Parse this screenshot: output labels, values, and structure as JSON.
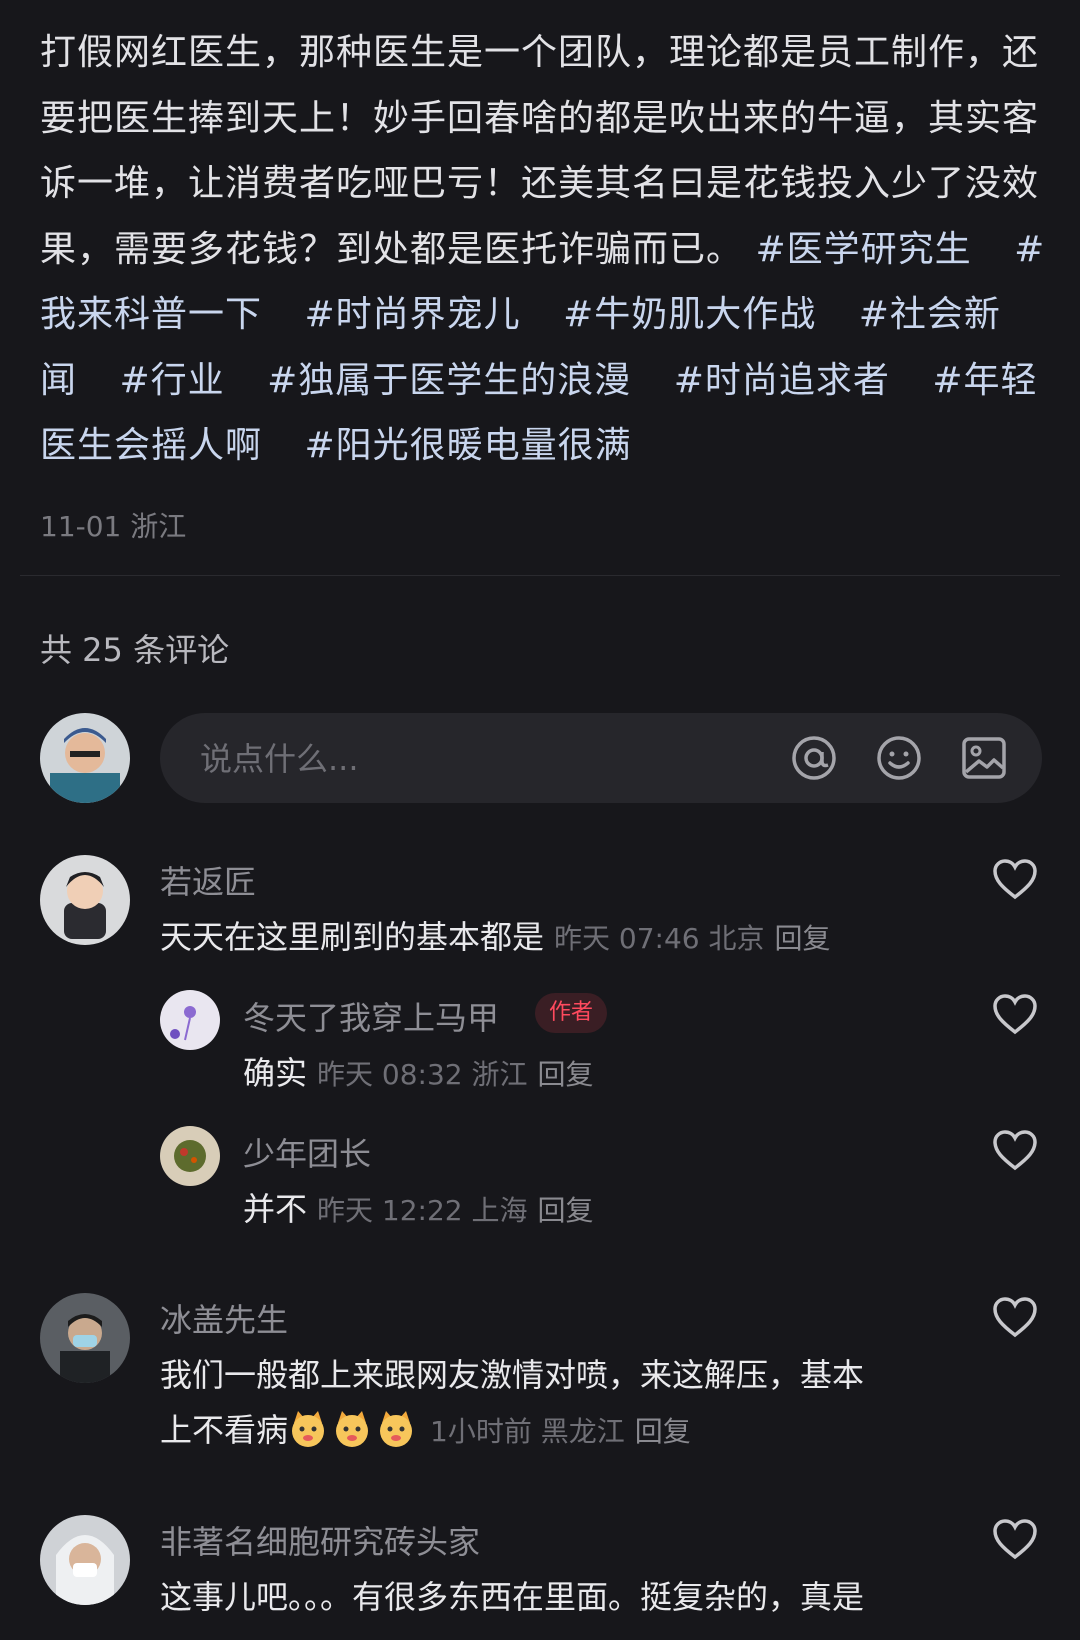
{
  "post": {
    "text": "打假网红医生，那种医生是一个团队，理论都是员工制作，还要把医生捧到天上！妙手回春啥的都是吹出来的牛逼，其实客诉一堆，让消费者吃哑巴亏！还美其名曰是花钱投入少了没效果，需要多花钱？到处都是医托诈骗而已。",
    "tags": [
      "#医学研究生",
      "#我来科普一下",
      "#时尚界宠儿",
      "#牛奶肌大作战",
      "#社会新闻",
      "#行业",
      "#独属于医学生的浪漫",
      "#时尚追求者",
      "#年轻医生会摇人啊",
      "#阳光很暖电量很满"
    ],
    "date_location": "11-01 浙江"
  },
  "comments_header": {
    "count_text": "共 25 条评论"
  },
  "input": {
    "placeholder": "说点什么...",
    "icons": [
      "at-icon",
      "emoji-icon",
      "image-icon"
    ]
  },
  "comments": [
    {
      "user": "若返匠",
      "text": "天天在这里刷到的基本都是",
      "meta": "昨天 07:46 北京",
      "reply": "回复"
    },
    {
      "user": "冬天了我穿上马甲",
      "badge": "作者",
      "text": "确实",
      "meta": "昨天 08:32 浙江",
      "reply": "回复"
    },
    {
      "user": "少年团长",
      "text": "并不",
      "meta": "昨天 12:22 上海",
      "reply": "回复"
    },
    {
      "user": "冰盖先生",
      "text": "我们一般都上来跟网友激情对喷，来这解压，基本",
      "text2": "上不看病",
      "meta": "1小时前 黑龙江",
      "reply": "回复"
    },
    {
      "user": "非著名细胞研究砖头家",
      "text": "这事儿吧。。。有很多东西在里面。挺复杂的，真是"
    }
  ],
  "colors": {
    "background": "#17171b",
    "badge": "#ff4a5e",
    "tag": "#c9d6ee"
  }
}
